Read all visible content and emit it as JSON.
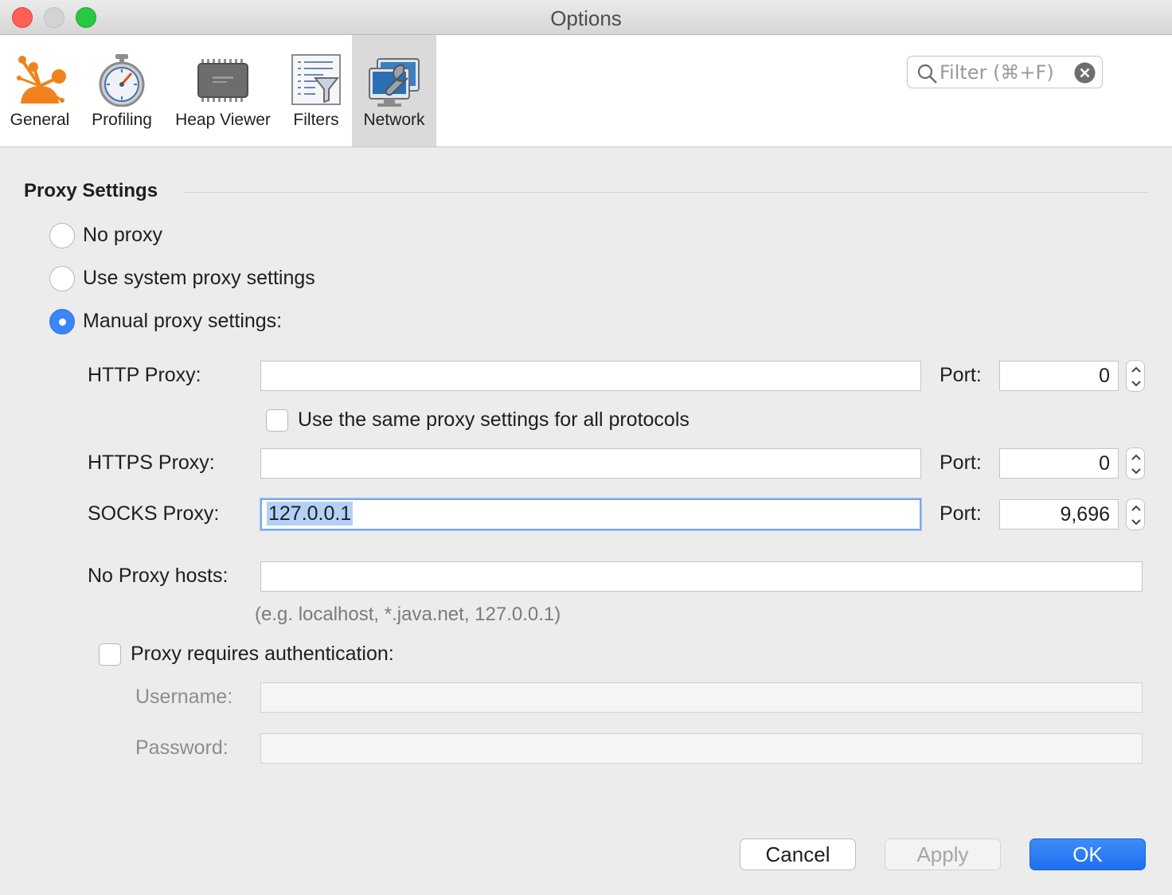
{
  "window": {
    "title": "Options"
  },
  "toolbar": {
    "tabs": [
      {
        "label": "General",
        "icon": "general-network-icon"
      },
      {
        "label": "Profiling",
        "icon": "stopwatch-icon"
      },
      {
        "label": "Heap Viewer",
        "icon": "memory-chip-icon"
      },
      {
        "label": "Filters",
        "icon": "filter-document-icon"
      },
      {
        "label": "Network",
        "icon": "network-wrench-icon",
        "selected": true
      }
    ],
    "filter_placeholder": "Filter (⌘+F)"
  },
  "proxy": {
    "section_title": "Proxy Settings",
    "options": [
      {
        "label": "No proxy",
        "selected": false
      },
      {
        "label": "Use system proxy settings",
        "selected": false
      },
      {
        "label": "Manual proxy settings:",
        "selected": true
      }
    ],
    "http_label": "HTTP Proxy:",
    "http_value": "",
    "http_port_label": "Port:",
    "http_port": "0",
    "same_settings_label": "Use the same proxy settings for all protocols",
    "same_settings_checked": false,
    "https_label": "HTTPS Proxy:",
    "https_value": "",
    "https_port_label": "Port:",
    "https_port": "0",
    "socks_label": "SOCKS Proxy:",
    "socks_value": "127.0.0.1",
    "socks_port_label": "Port:",
    "socks_port": "9,696",
    "no_proxy_label": "No Proxy hosts:",
    "no_proxy_value": "",
    "no_proxy_hint": "(e.g. localhost, *.java.net, 127.0.0.1)",
    "auth_label": "Proxy requires authentication:",
    "auth_checked": false,
    "username_label": "Username:",
    "username_value": "",
    "password_label": "Password:",
    "password_value": ""
  },
  "buttons": {
    "cancel": "Cancel",
    "apply": "Apply",
    "ok": "OK"
  },
  "colors": {
    "accent": "#3a86f7",
    "toolbar_selected": "#dadada",
    "general_icon": "#f0821e"
  }
}
